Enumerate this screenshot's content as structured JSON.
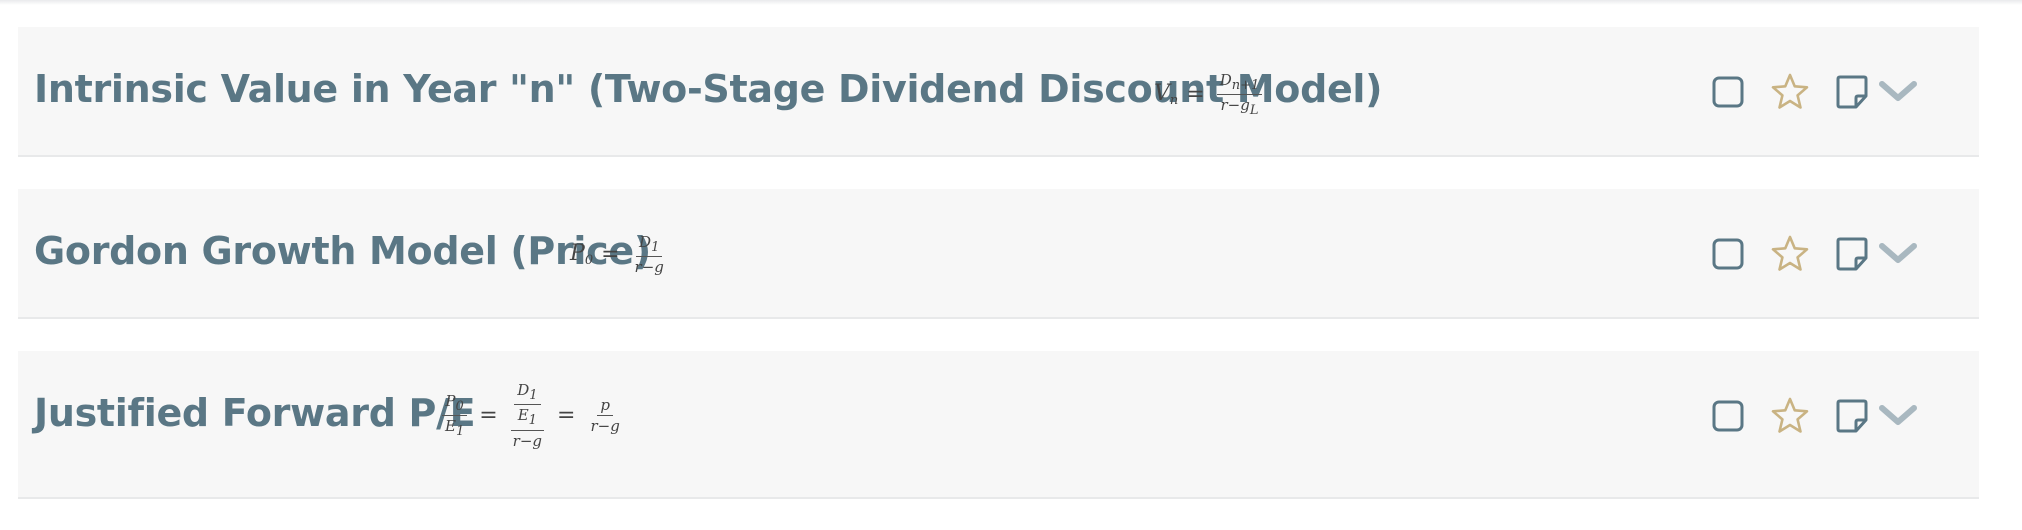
{
  "colors": {
    "title": "#5a7785",
    "card_bg": "#f7f7f7",
    "checkbox": "#5a7785",
    "star": "#c9b383",
    "note": "#5a7785",
    "chevron": "#a9b8c0"
  },
  "formulas": [
    {
      "title": "Intrinsic Value in Year \"n\" (Two-Stage Dividend Discount Model)",
      "lhs": "V",
      "lhs_sub": "n",
      "eq": "=",
      "num": "D",
      "num_sub": "n+1",
      "den": "r−g",
      "den_sub": "L"
    },
    {
      "title": "Gordon Growth Model (Price)",
      "lhs": "P",
      "lhs_sub": "0",
      "eq": "=",
      "num": "D",
      "num_sub": "1",
      "den": "r−g"
    },
    {
      "title": "Justified Forward P/E",
      "lhs_num": "P",
      "lhs_num_sub": "0",
      "lhs_den": "E",
      "lhs_den_sub": "1",
      "eq1": "=",
      "mid_num_num": "D",
      "mid_num_num_sub": "1",
      "mid_num_den": "E",
      "mid_num_den_sub": "1",
      "mid_den": "r−g",
      "eq2": "=",
      "rhs_num": "p",
      "rhs_den": "r−g"
    }
  ],
  "icons": {
    "checkbox": "checkbox-icon",
    "favorite": "star-icon",
    "note": "note-icon",
    "expand": "chevron-down-icon"
  }
}
